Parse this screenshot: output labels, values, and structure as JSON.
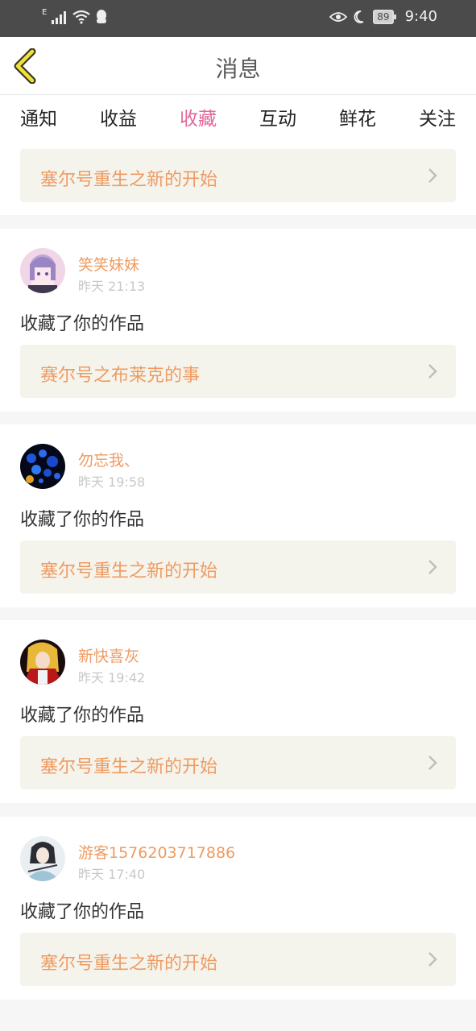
{
  "status_bar": {
    "network": "E",
    "battery": "89",
    "time": "9:40"
  },
  "header": {
    "title": "消息"
  },
  "tabs": [
    {
      "label": "通知",
      "active": false
    },
    {
      "label": "收益",
      "active": false
    },
    {
      "label": "收藏",
      "active": true
    },
    {
      "label": "互动",
      "active": false
    },
    {
      "label": "鲜花",
      "active": false
    },
    {
      "label": "关注",
      "active": false
    }
  ],
  "first_work": "塞尔号重生之新的开始",
  "messages": [
    {
      "user": "笑笑妹妹",
      "time": "昨天 21:13",
      "action": "收藏了你的作品",
      "work": "赛尔号之布莱克的事"
    },
    {
      "user": "勿忘我、",
      "time": "昨天 19:58",
      "action": "收藏了你的作品",
      "work": "塞尔号重生之新的开始"
    },
    {
      "user": "新快喜灰",
      "time": "昨天 19:42",
      "action": "收藏了你的作品",
      "work": "塞尔号重生之新的开始"
    },
    {
      "user": "游客1576203717886",
      "time": "昨天 17:40",
      "action": "收藏了你的作品",
      "work": "塞尔号重生之新的开始"
    }
  ],
  "colors": {
    "accent": "#e0699b",
    "work_text": "#ee9b62",
    "link_bg": "#f5f4ec",
    "status_bar": "#4b4b4b"
  }
}
